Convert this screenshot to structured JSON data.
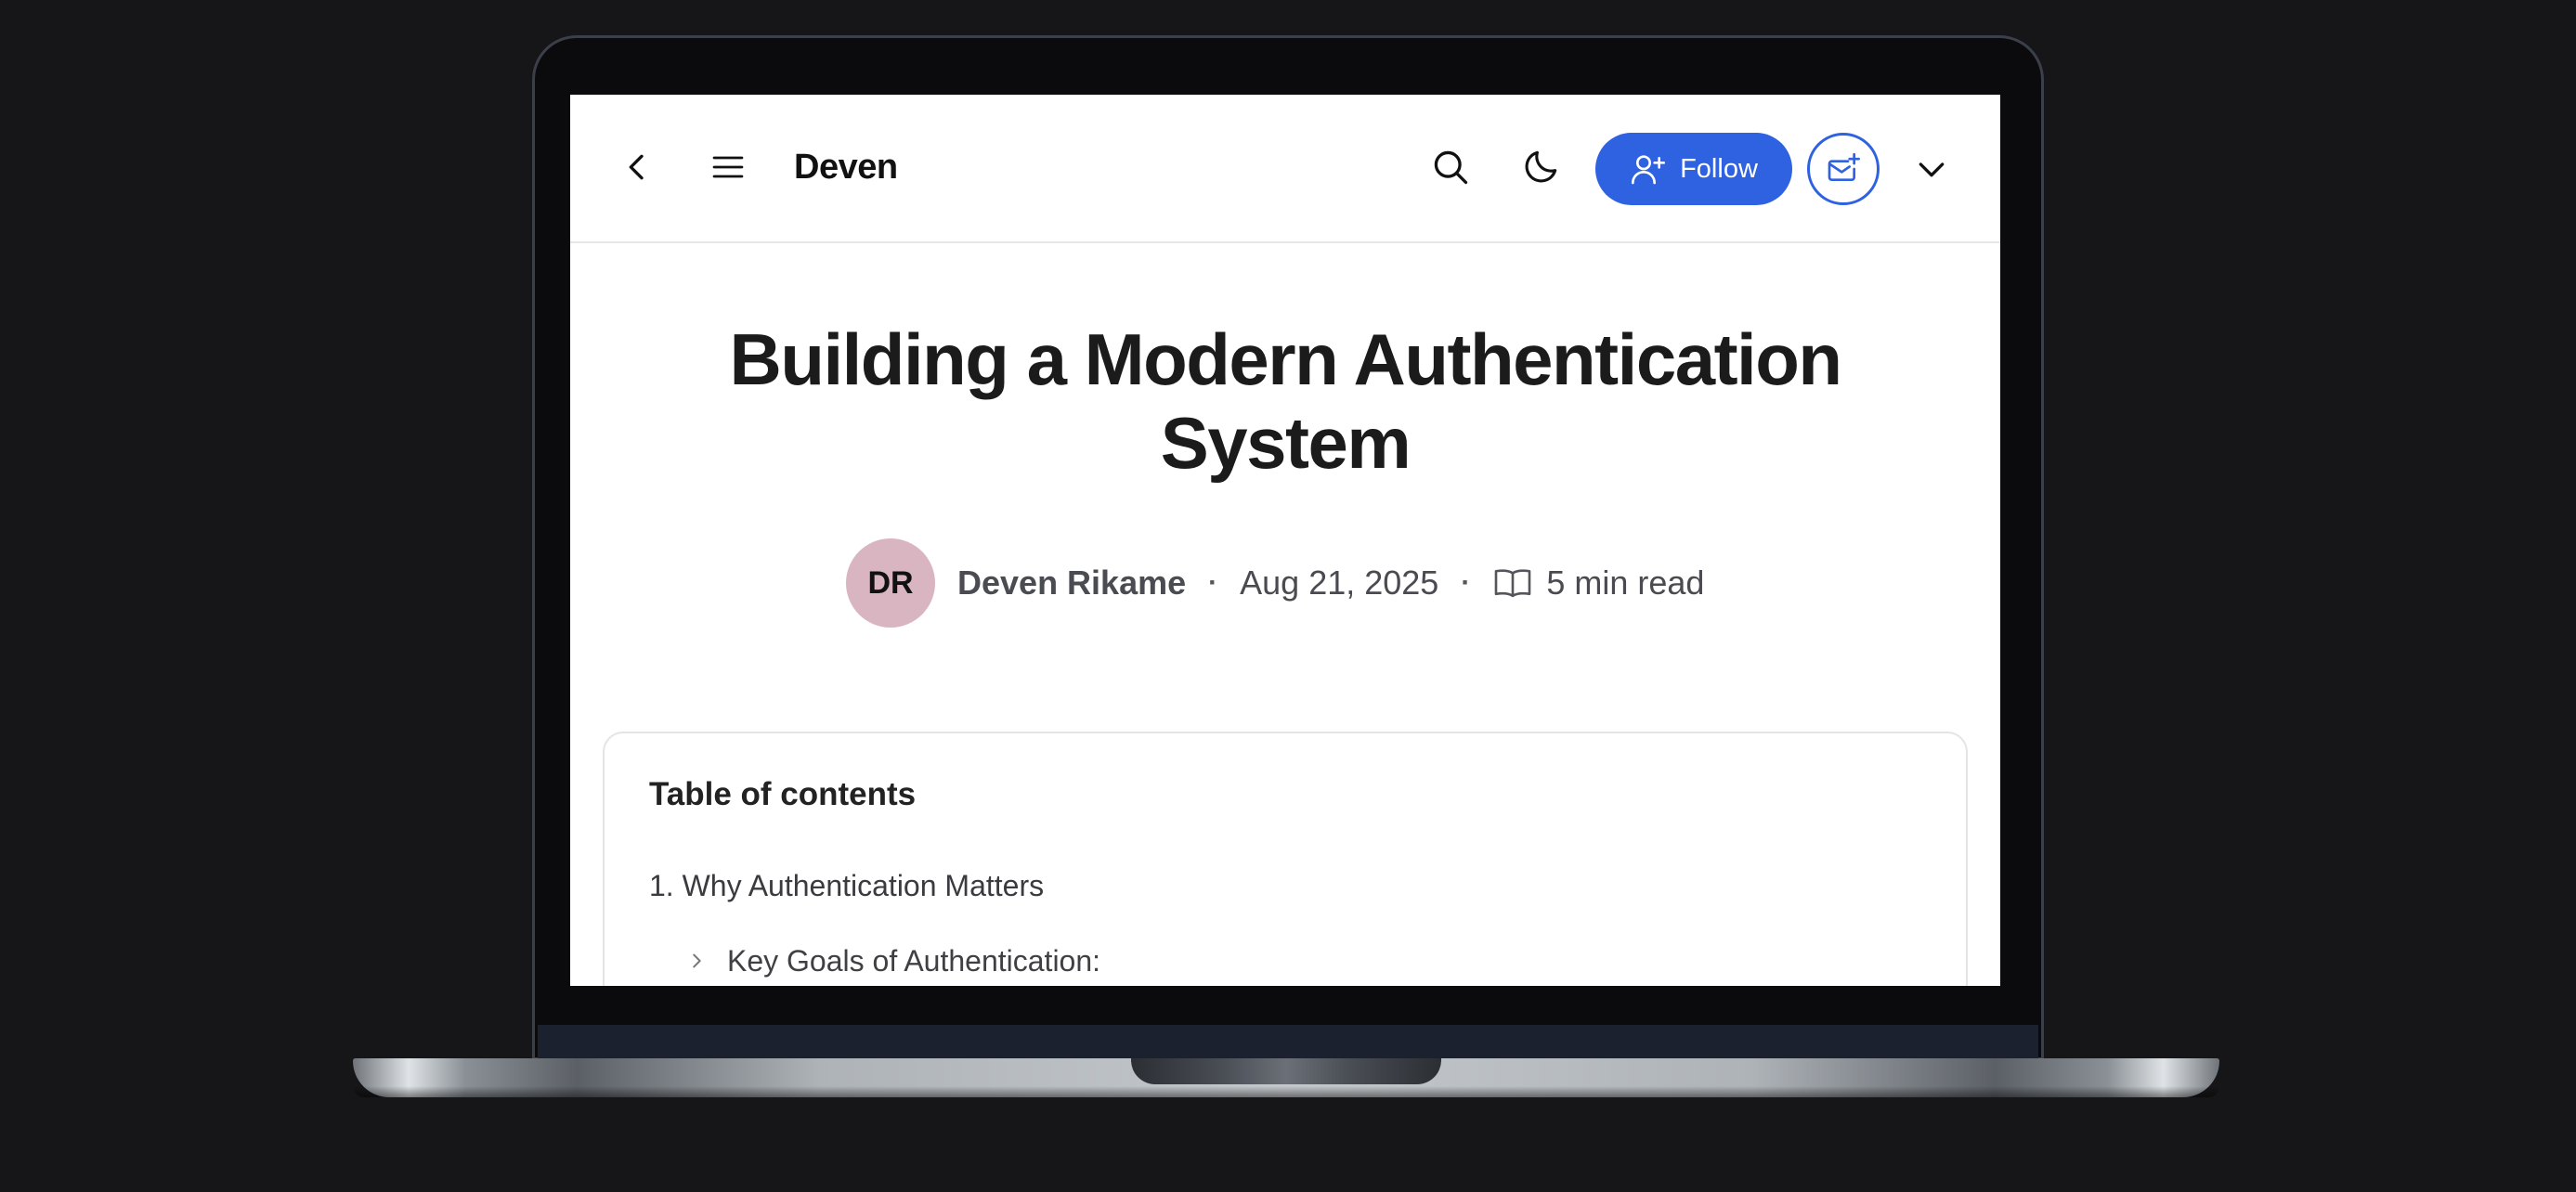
{
  "header": {
    "blog_name": "Deven",
    "follow_label": "Follow",
    "icons": [
      "back-icon",
      "menu-icon",
      "search-icon",
      "moon-icon",
      "user-plus-icon",
      "mail-plus-icon",
      "chevron-down-icon"
    ],
    "accent_color": "#2f62e0"
  },
  "article": {
    "title": "Building a Modern Authentication System",
    "author_initials": "DR",
    "author_name": "Deven Rikame",
    "date": "Aug 21, 2025",
    "separator": "·",
    "read_time": "5 min read",
    "avatar_color": "#d9b5c2"
  },
  "toc": {
    "title": "Table of contents",
    "items": [
      {
        "label": "1. Why Authentication Matters",
        "children": [
          {
            "label": "Key Goals of Authentication:"
          }
        ]
      }
    ]
  }
}
